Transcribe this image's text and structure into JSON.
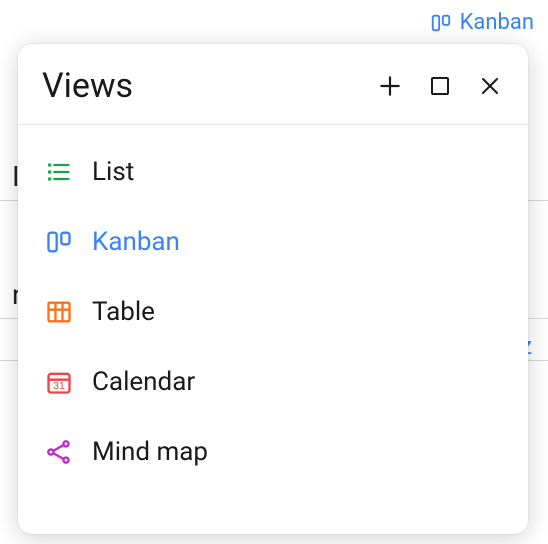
{
  "topbar": {
    "current_view_label": "Kanban"
  },
  "panel": {
    "title": "Views",
    "views": [
      {
        "id": "list",
        "label": "List",
        "icon": "list-icon",
        "color": "#16a34a",
        "active": false
      },
      {
        "id": "kanban",
        "label": "Kanban",
        "icon": "kanban-icon",
        "color": "#3b82f6",
        "active": true
      },
      {
        "id": "table",
        "label": "Table",
        "icon": "table-icon",
        "color": "#f97316",
        "active": false
      },
      {
        "id": "calendar",
        "label": "Calendar",
        "icon": "calendar-icon",
        "color": "#ef4444",
        "active": false
      },
      {
        "id": "mindmap",
        "label": "Mind map",
        "icon": "mindmap-icon",
        "color": "#c026d3",
        "active": false
      }
    ]
  }
}
